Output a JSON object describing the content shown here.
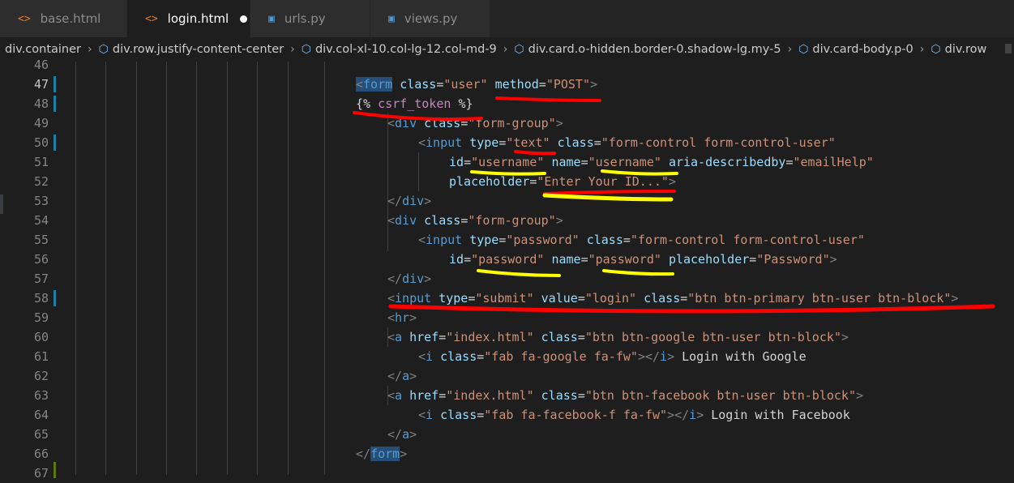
{
  "tabs": [
    {
      "label": "base.html",
      "icon": "html-icon",
      "active": false
    },
    {
      "label": "login.html",
      "icon": "html-icon",
      "active": true,
      "unsaved": true
    },
    {
      "label": "urls.py",
      "icon": "python-icon",
      "active": false
    },
    {
      "label": "views.py",
      "icon": "python-icon",
      "active": false
    }
  ],
  "breadcrumb": [
    "div.container",
    "div.row.justify-content-center",
    "div.col-xl-10.col-lg-12.col-md-9",
    "div.card.o-hidden.border-0.shadow-lg.my-5",
    "div.card-body.p-0",
    "div.row"
  ],
  "line_numbers": [
    "46",
    "47",
    "48",
    "49",
    "50",
    "51",
    "52",
    "53",
    "54",
    "55",
    "56",
    "57",
    "58",
    "59",
    "60",
    "61",
    "62",
    "63",
    "64",
    "65",
    "66",
    "67"
  ],
  "code": {
    "l47": {
      "open": "<",
      "tag": "form",
      "sp1": " ",
      "a1": "class",
      "eq1": "=",
      "v1": "\"user\"",
      "sp2": " ",
      "a2": "method",
      "eq2": "=",
      "v2": "\"POST\"",
      "close": ">"
    },
    "l48": {
      "open": "{%",
      "sp": " ",
      "name": "csrf_token",
      "sp2": " ",
      "close": "%}"
    },
    "l49": {
      "open": "<",
      "tag": "div",
      "sp1": " ",
      "a1": "class",
      "eq1": "=",
      "v1": "\"form-group\"",
      "close": ">"
    },
    "l50": {
      "open": "<",
      "tag": "input",
      "sp1": " ",
      "a1": "type",
      "eq1": "=",
      "v1": "\"text\"",
      "sp2": " ",
      "a2": "class",
      "eq2": "=",
      "v2": "\"form-control form-control-user\""
    },
    "l51": {
      "a1": "id",
      "eq1": "=",
      "v1": "\"username\"",
      "sp1": " ",
      "a2": "name",
      "eq2": "=",
      "v2": "\"username\"",
      "sp2": " ",
      "a3": "aria-describedby",
      "eq3": "=",
      "v3": "\"emailHelp\""
    },
    "l52": {
      "a1": "placeholder",
      "eq1": "=",
      "v1": "\"Enter Your ID...\"",
      "close": ">"
    },
    "l53": {
      "open": "</",
      "tag": "div",
      "close": ">"
    },
    "l54": {
      "open": "<",
      "tag": "div",
      "sp1": " ",
      "a1": "class",
      "eq1": "=",
      "v1": "\"form-group\"",
      "close": ">"
    },
    "l55": {
      "open": "<",
      "tag": "input",
      "sp1": " ",
      "a1": "type",
      "eq1": "=",
      "v1": "\"password\"",
      "sp2": " ",
      "a2": "class",
      "eq2": "=",
      "v2": "\"form-control form-control-user\""
    },
    "l56": {
      "a1": "id",
      "eq1": "=",
      "v1": "\"password\"",
      "sp1": " ",
      "a2": "name",
      "eq2": "=",
      "v2": "\"password\"",
      "sp2": " ",
      "a3": "placeholder",
      "eq3": "=",
      "v3": "\"Password\"",
      "close": ">"
    },
    "l57": {
      "open": "</",
      "tag": "div",
      "close": ">"
    },
    "l58": {
      "open": "<",
      "tag": "input",
      "sp1": " ",
      "a1": "type",
      "eq1": "=",
      "v1": "\"submit\"",
      "sp2": " ",
      "a2": "value",
      "eq2": "=",
      "v2": "\"login\"",
      "sp3": " ",
      "a3": "class",
      "eq3": "=",
      "v3": "\"btn btn-primary btn-user btn-block\"",
      "close": ">"
    },
    "l59": {
      "open": "<",
      "tag": "hr",
      "close": ">"
    },
    "l60": {
      "open": "<",
      "tag": "a",
      "sp1": " ",
      "a1": "href",
      "eq1": "=",
      "v1": "\"index.html\"",
      "sp2": " ",
      "a2": "class",
      "eq2": "=",
      "v2": "\"btn btn-google btn-user btn-block\"",
      "close": ">"
    },
    "l61": {
      "open": "<",
      "tag": "i",
      "sp1": " ",
      "a1": "class",
      "eq1": "=",
      "v1": "\"fab fa-google fa-fw\"",
      "close": ">",
      "eopen": "</",
      "etag": "i",
      "eclose": ">",
      "text": " Login with Google"
    },
    "l62": {
      "open": "</",
      "tag": "a",
      "close": ">"
    },
    "l63": {
      "open": "<",
      "tag": "a",
      "sp1": " ",
      "a1": "href",
      "eq1": "=",
      "v1": "\"index.html\"",
      "sp2": " ",
      "a2": "class",
      "eq2": "=",
      "v2": "\"btn btn-facebook btn-user btn-block\"",
      "close": ">"
    },
    "l64": {
      "open": "<",
      "tag": "i",
      "sp1": " ",
      "a1": "class",
      "eq1": "=",
      "v1": "\"fab fa-facebook-f fa-fw\"",
      "close": ">",
      "eopen": "</",
      "etag": "i",
      "eclose": ">",
      "text": " Login with Facebook"
    },
    "l65": {
      "open": "</",
      "tag": "a",
      "close": ">"
    },
    "l66": {
      "open": "</",
      "tag": "form",
      "close": ">"
    }
  },
  "colors": {
    "tag": "#569cd6",
    "attr": "#9cdcfe",
    "string": "#ce9178",
    "punct": "#808080",
    "annot_red": "#ff0000",
    "annot_yellow": "#ffff00"
  }
}
